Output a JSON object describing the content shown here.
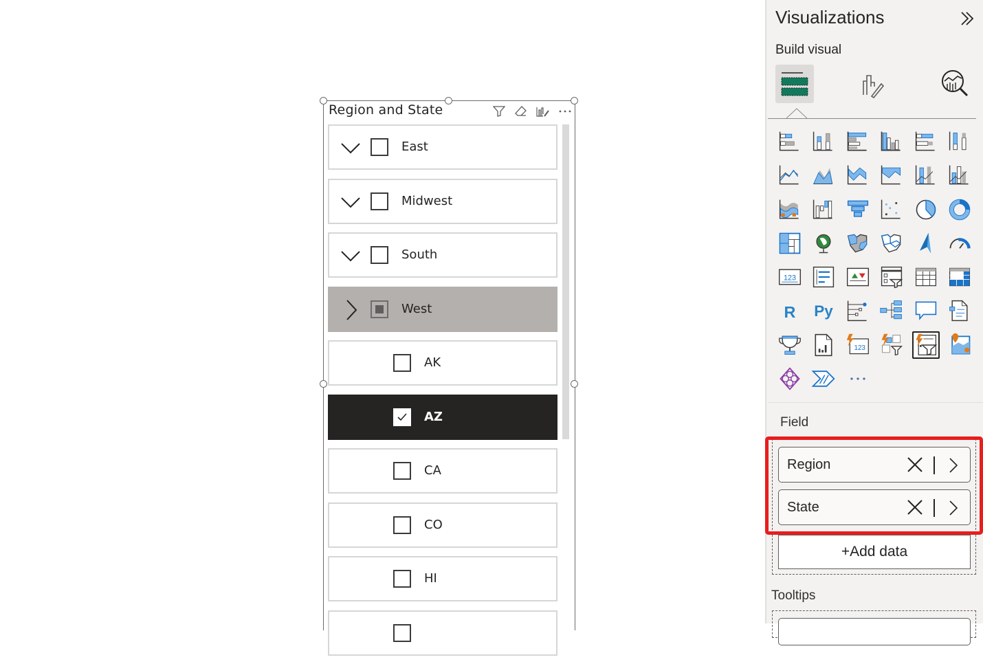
{
  "slicer": {
    "title": "Region and State",
    "tools": [
      "filter-icon",
      "eraser-icon",
      "format-visual-icon",
      "more-options-icon"
    ],
    "items": [
      {
        "label": "East",
        "level": 0,
        "expanded": true,
        "state": "unchecked"
      },
      {
        "label": "Midwest",
        "level": 0,
        "expanded": true,
        "state": "unchecked"
      },
      {
        "label": "South",
        "level": 0,
        "expanded": true,
        "state": "unchecked"
      },
      {
        "label": "West",
        "level": 0,
        "expanded": false,
        "state": "partial"
      },
      {
        "label": "AK",
        "level": 1,
        "state": "unchecked"
      },
      {
        "label": "AZ",
        "level": 1,
        "state": "checked"
      },
      {
        "label": "CA",
        "level": 1,
        "state": "unchecked"
      },
      {
        "label": "CO",
        "level": 1,
        "state": "unchecked"
      },
      {
        "label": "HI",
        "level": 1,
        "state": "unchecked"
      },
      {
        "label": "",
        "level": 1,
        "state": "unchecked"
      }
    ]
  },
  "pane": {
    "title": "Visualizations",
    "collapse_icon": "double-chevron-right-icon",
    "build_label": "Build visual",
    "build_tabs": [
      {
        "name": "fields-tab",
        "icon": "field-wells-icon",
        "active": true
      },
      {
        "name": "format-tab",
        "icon": "format-brush-icon",
        "active": false
      },
      {
        "name": "analytics-tab",
        "icon": "analytics-magnifier-icon",
        "active": false
      }
    ],
    "visuals": [
      "stacked-bar-chart",
      "stacked-column-chart",
      "clustered-bar-chart",
      "clustered-column-chart",
      "100-stacked-bar-chart",
      "100-stacked-column-chart",
      "line-chart",
      "area-chart",
      "stacked-area-chart",
      "100-stacked-area-chart",
      "line-stacked-column-chart",
      "line-clustered-column-chart",
      "ribbon-chart",
      "waterfall-chart",
      "funnel-chart",
      "scatter-chart",
      "pie-chart",
      "donut-chart",
      "treemap",
      "map",
      "filled-map",
      "shape-map",
      "azure-map",
      "gauge",
      "card",
      "multi-row-card",
      "kpi",
      "slicer",
      "table",
      "matrix",
      "r-script-visual",
      "python-visual",
      "key-influencers",
      "decomposition-tree",
      "qa-visual",
      "smart-narrative",
      "metrics",
      "paginated-report",
      "card-new",
      "slicer-new",
      "button-slicer",
      "arcgis-map",
      "power-apps",
      "power-automate",
      "more-visuals"
    ],
    "selected_visual": "button-slicer",
    "field_section": {
      "label": "Field",
      "fields": [
        {
          "label": "Region"
        },
        {
          "label": "State"
        }
      ],
      "add_label": "+Add data"
    },
    "tooltips_label": "Tooltips"
  },
  "colors": {
    "accent": "#118dff",
    "highlight": "#e81e1e",
    "selected_row": "#252423",
    "partial_row": "#b3b0ad"
  }
}
